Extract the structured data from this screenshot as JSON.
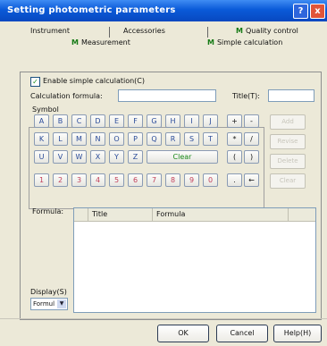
{
  "window": {
    "title": "Setting photometric parameters",
    "help_label": "?",
    "close_label": "x"
  },
  "tabs": [
    {
      "label": "Instrument",
      "icon": "none"
    },
    {
      "label": "Accessories",
      "icon": "none"
    },
    {
      "label": "Quality control",
      "icon": "M"
    },
    {
      "label": "Measurement",
      "icon": "M"
    },
    {
      "label": "Simple calculation",
      "icon": "M"
    }
  ],
  "enable_simple_calc": {
    "label": "Enable simple calculation(C)",
    "checked": true,
    "check_mark": "✓"
  },
  "formula_label": "Calculation formula:",
  "formula_value": "",
  "title_label": "Title(T):",
  "title_value": "",
  "symbol_label": "Symbol",
  "letters_row1": [
    "A",
    "B",
    "C",
    "D",
    "E",
    "F",
    "G",
    "H",
    "I",
    "J"
  ],
  "letters_row2": [
    "K",
    "L",
    "M",
    "N",
    "O",
    "P",
    "Q",
    "R",
    "S",
    "T"
  ],
  "letters_row3": [
    "U",
    "V",
    "W",
    "X",
    "Y",
    "Z"
  ],
  "clear_key": "Clear",
  "digits": [
    "1",
    "2",
    "3",
    "4",
    "5",
    "6",
    "7",
    "8",
    "9",
    "0"
  ],
  "operators": [
    "+",
    "-",
    "*",
    "/",
    "(",
    ")"
  ],
  "dot_key": ".",
  "backspace_key": "←",
  "side_buttons": [
    "Add",
    "Revise",
    "Delete",
    "Clear"
  ],
  "formula_list": {
    "label": "Formula:",
    "columns": [
      "Title",
      "Formula"
    ]
  },
  "display": {
    "label": "Display(S)",
    "value": "Formul"
  },
  "buttons": {
    "ok": "OK",
    "cancel": "Cancel",
    "help": "Help(H)"
  }
}
